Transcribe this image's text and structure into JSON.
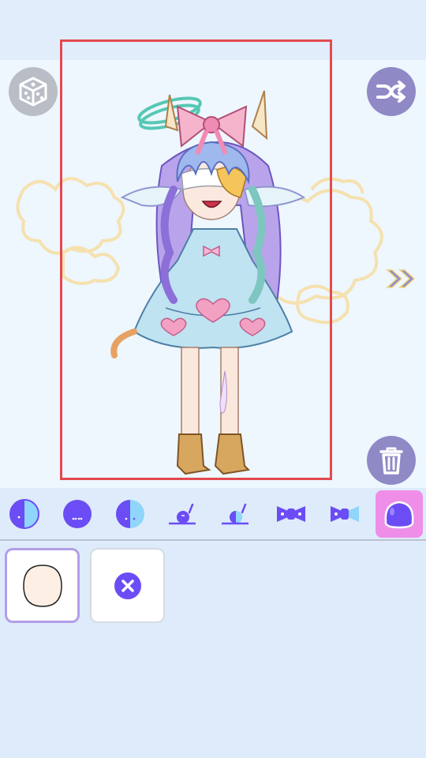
{
  "toolbar": {
    "dice_icon": "dice-icon",
    "shuffle_icon": "shuffle-icon",
    "trash_icon": "trash-icon",
    "next_icon": "double-chevron-right-icon"
  },
  "categories": [
    {
      "icon": "face-half-icon",
      "active": false
    },
    {
      "icon": "face-dots-icon",
      "active": false
    },
    {
      "icon": "face-half-blue-icon",
      "active": false
    },
    {
      "icon": "eye-brow-icon",
      "active": false
    },
    {
      "icon": "eye-brow-half-icon",
      "active": false
    },
    {
      "icon": "bow-icon",
      "active": false
    },
    {
      "icon": "bow-half-icon",
      "active": false
    },
    {
      "icon": "blush-blob-icon",
      "active": true
    }
  ],
  "items": [
    {
      "icon": "skin-face-icon",
      "selected": true
    },
    {
      "icon": "remove-x-icon",
      "selected": false
    }
  ],
  "colors": {
    "accent": "#6b4cf5",
    "active_category": "#ee8ee8",
    "frame": "#e24a4f",
    "button_purple": "#8f89c6",
    "button_gray": "#b9bdc6"
  }
}
